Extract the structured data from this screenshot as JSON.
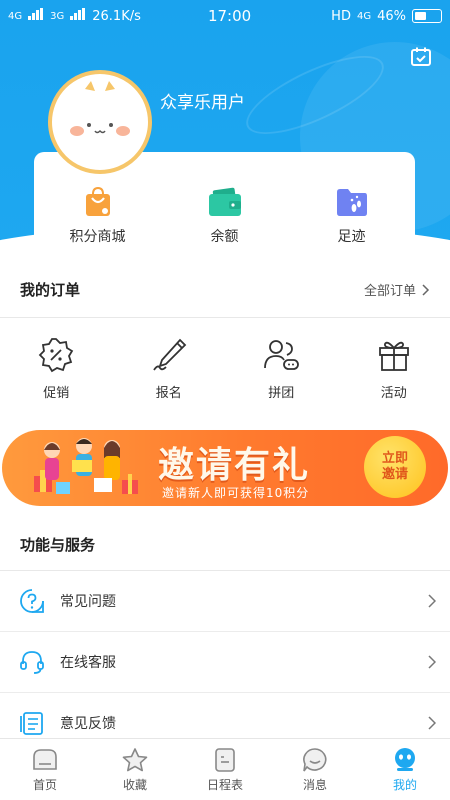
{
  "status_bar": {
    "network1": "4G",
    "network2": "3G",
    "speed": "26.1K/s",
    "time": "17:00",
    "hd": "HD",
    "network3": "4G",
    "battery": "46%",
    "battery_level": 0.46
  },
  "profile": {
    "username": "众享乐用户"
  },
  "quick_links": [
    {
      "label": "积分商城",
      "icon": "shopping-bag-icon",
      "color": "#f8a23c"
    },
    {
      "label": "余额",
      "icon": "wallet-icon",
      "color": "#2cc7a3"
    },
    {
      "label": "足迹",
      "icon": "footprint-folder-icon",
      "color": "#6f82f2"
    }
  ],
  "orders": {
    "title": "我的订单",
    "all_orders": "全部订单",
    "items": [
      {
        "label": "促销",
        "icon": "promotion-tag-icon"
      },
      {
        "label": "报名",
        "icon": "pencil-icon"
      },
      {
        "label": "拼团",
        "icon": "group-icon"
      },
      {
        "label": "活动",
        "icon": "gift-icon"
      }
    ]
  },
  "banner": {
    "title": "邀请有礼",
    "subtitle": "邀请新人即可获得10积分",
    "button_line1": "立即",
    "button_line2": "邀请"
  },
  "services": {
    "title": "功能与服务",
    "items": [
      {
        "label": "常见问题",
        "icon": "question-icon"
      },
      {
        "label": "在线客服",
        "icon": "headset-icon"
      },
      {
        "label": "意见反馈",
        "icon": "feedback-icon"
      }
    ]
  },
  "tabbar": {
    "items": [
      {
        "label": "首页",
        "icon": "home-icon",
        "active": false
      },
      {
        "label": "收藏",
        "icon": "star-icon",
        "active": false
      },
      {
        "label": "日程表",
        "icon": "schedule-icon",
        "active": false
      },
      {
        "label": "消息",
        "icon": "message-icon",
        "active": false
      },
      {
        "label": "我的",
        "icon": "profile-icon",
        "active": true
      }
    ]
  },
  "colors": {
    "primary": "#1ea8f0",
    "banner_orange": "#ff7a2e",
    "avatar_ring": "#f6c66a"
  }
}
